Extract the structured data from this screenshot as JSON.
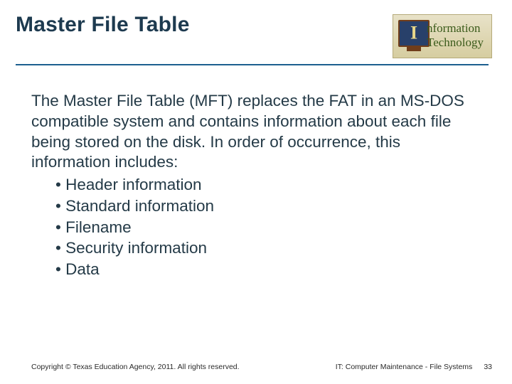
{
  "header": {
    "title": "Master File Table",
    "logo": {
      "line1": "nformation",
      "line2": "Technology"
    }
  },
  "body": {
    "intro": "The Master File Table (MFT) replaces the FAT in an MS-DOS compatible system and contains information about each file being stored on the disk. In order of occurrence, this information includes:",
    "bullets": [
      "Header information",
      "Standard information",
      "Filename",
      "Security information",
      "Data"
    ]
  },
  "footer": {
    "copyright": "Copyright © Texas Education Agency, 2011. All rights reserved.",
    "course": "IT: Computer Maintenance - File Systems",
    "page": "33"
  }
}
